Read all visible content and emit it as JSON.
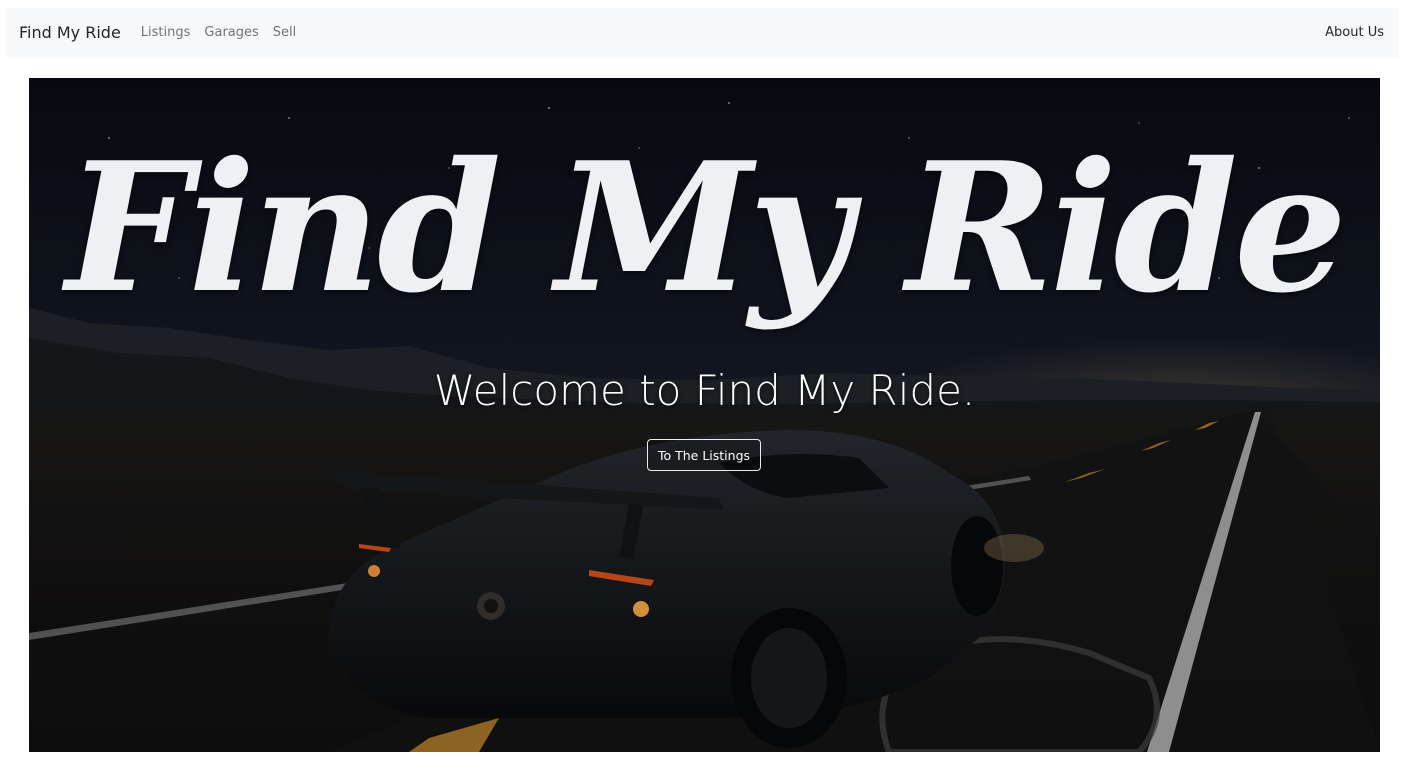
{
  "navbar": {
    "brand": "Find My Ride",
    "links": [
      {
        "label": "Listings"
      },
      {
        "label": "Garages"
      },
      {
        "label": "Sell"
      }
    ],
    "right_link": "About Us"
  },
  "hero": {
    "logo_text": "Find My Ride",
    "welcome_text": "Welcome to Find My Ride.",
    "button_label": "To The Listings"
  },
  "colors": {
    "navbar_bg": "#f8f9fa",
    "hero_night_sky": "#0b0e14",
    "logo_text": "#eef0f4",
    "button_border": "#e9ecef"
  }
}
